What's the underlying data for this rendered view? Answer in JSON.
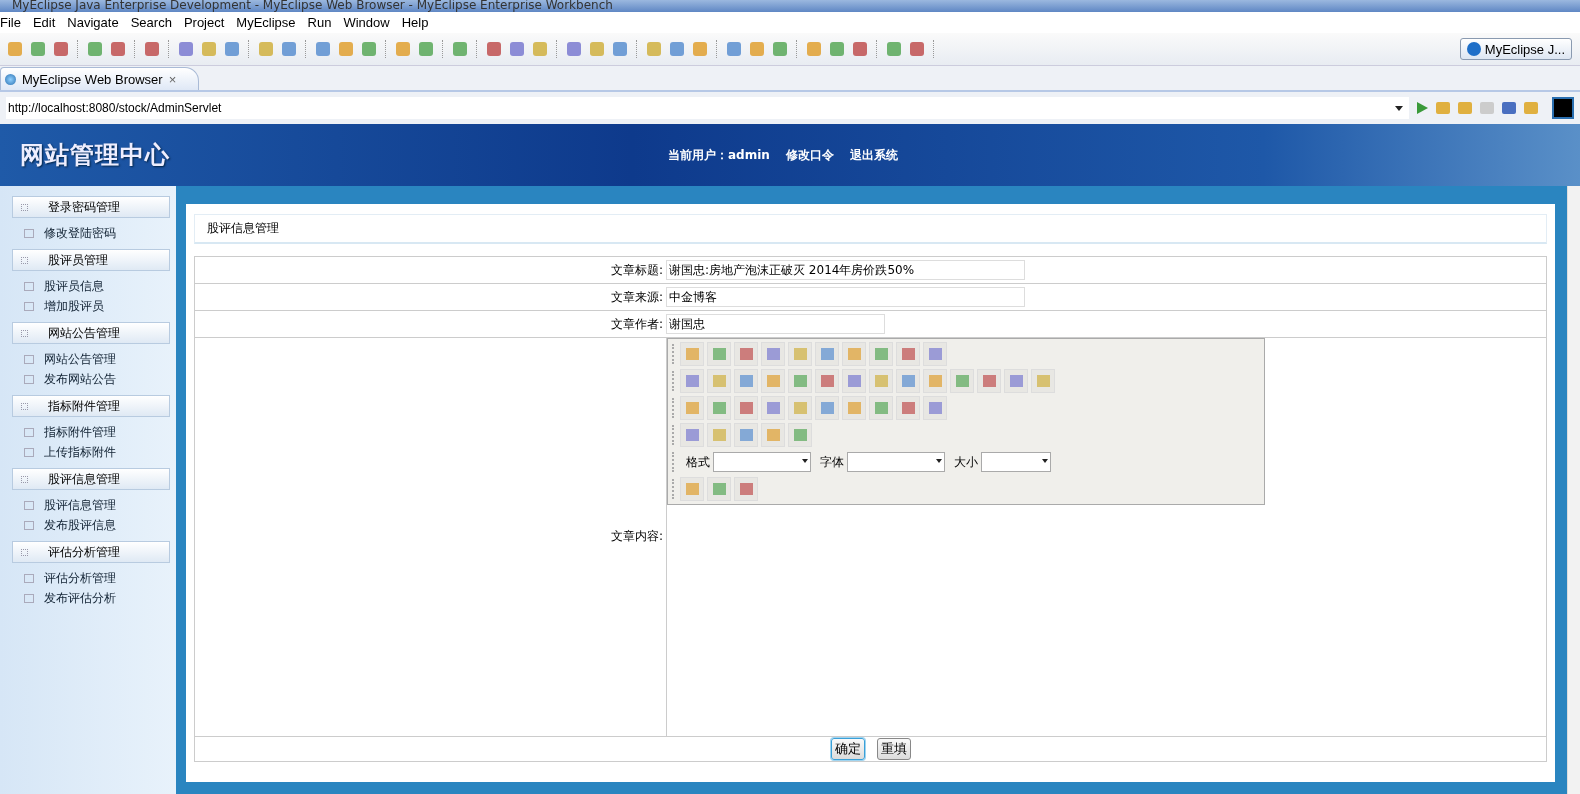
{
  "window": {
    "title": "MyEclipse Java Enterprise Development - MyEclipse Web Browser - MyEclipse Enterprise Workbench"
  },
  "menu": [
    "File",
    "Edit",
    "Navigate",
    "Search",
    "Project",
    "MyEclipse",
    "Run",
    "Window",
    "Help"
  ],
  "perspective": {
    "label": "MyEclipse J..."
  },
  "editor_tab": {
    "label": "MyEclipse Web Browser",
    "close": "×"
  },
  "address": {
    "value": "http://localhost:8080/stock/AdminServlet"
  },
  "site": {
    "logo": "网站管理中心",
    "user_label": "当前用户：admin",
    "links": [
      "修改口令",
      "退出系统"
    ]
  },
  "sidebar": [
    {
      "label": "登录密码管理",
      "children": [
        "修改登陆密码"
      ]
    },
    {
      "label": "股评员管理",
      "children": [
        "股评员信息",
        "增加股评员"
      ]
    },
    {
      "label": "网站公告管理",
      "children": [
        "网站公告管理",
        "发布网站公告"
      ]
    },
    {
      "label": "指标附件管理",
      "children": [
        "指标附件管理",
        "上传指标附件"
      ]
    },
    {
      "label": "股评信息管理",
      "children": [
        "股评信息管理",
        "发布股评信息"
      ]
    },
    {
      "label": "评估分析管理",
      "children": [
        "评估分析管理",
        "发布评估分析"
      ]
    }
  ],
  "panel_title": "股评信息管理",
  "form": [
    {
      "kind": "field",
      "label": "文章标题:",
      "value": "谢国忠:房地产泡沫正破灭 2014年房价跌50%",
      "wide": true
    },
    {
      "kind": "field",
      "label": "文章来源:",
      "value": "中金博客",
      "wide": true
    },
    {
      "kind": "field",
      "label": "文章作者:",
      "value": "谢国忠",
      "wide": false
    },
    {
      "kind": "editor",
      "label": "文章内容:",
      "dropdowns": [
        "格式",
        "字体",
        "大小"
      ]
    }
  ],
  "buttons": [
    {
      "label": "确定",
      "focused": true
    },
    {
      "label": "重填",
      "focused": false
    }
  ]
}
